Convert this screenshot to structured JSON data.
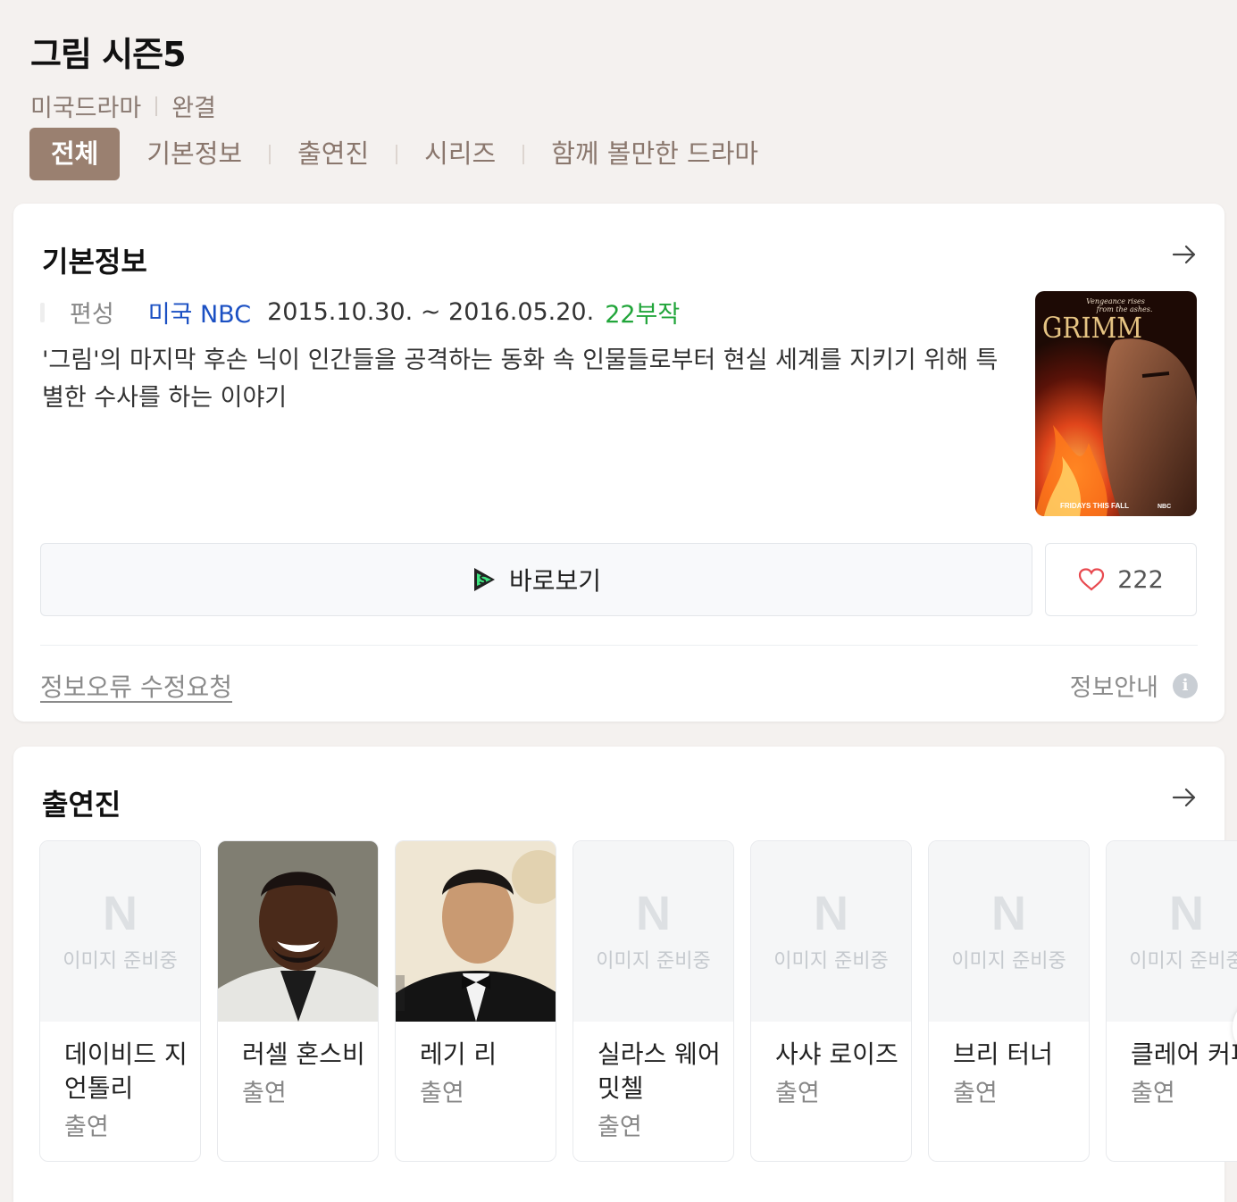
{
  "header": {
    "title": "그림 시즌5",
    "genre": "미국드라마",
    "status": "완결"
  },
  "tabs": [
    {
      "label": "전체",
      "active": true
    },
    {
      "label": "기본정보"
    },
    {
      "label": "출연진"
    },
    {
      "label": "시리즈"
    },
    {
      "label": "함께 볼만한 드라마"
    }
  ],
  "info": {
    "heading": "기본정보",
    "meta_label": "편성",
    "network": "미국 NBC",
    "dates": "2015.10.30. ~ 2016.05.20.",
    "episodes": "22부작",
    "description": "'그림'의 마지막 후손 닉이 인간들을 공격하는 동화 속 인물들로부터 현실 세계를 지키기 위해 특별한 수사를 하는 이야기",
    "poster": {
      "tagline_1": "Vengeance rises",
      "tagline_2": "from the ashes.",
      "logo": "GRIMM",
      "footer": "FRIDAYS THIS FALL",
      "footer_net": "NBC"
    },
    "watch_label": "바로보기",
    "like_count": "222",
    "edit_request": "정보오류 수정요청",
    "info_guide": "정보안내",
    "info_icon": "i"
  },
  "cast": {
    "heading": "출연진",
    "placeholder_logo": "N",
    "placeholder_text": "이미지 준비중",
    "members": [
      {
        "name": "데이비드 지언톨리",
        "role": "출연",
        "has_photo": false
      },
      {
        "name": "러셀 혼스비",
        "role": "출연",
        "has_photo": true
      },
      {
        "name": "레기 리",
        "role": "출연",
        "has_photo": true
      },
      {
        "name": "실라스 웨어 밋첼",
        "role": "출연",
        "has_photo": false
      },
      {
        "name": "사샤 로이즈",
        "role": "출연",
        "has_photo": false
      },
      {
        "name": "브리 터너",
        "role": "출연",
        "has_photo": false
      },
      {
        "name": "클레어 커피",
        "role": "출연",
        "has_photo": false
      }
    ]
  },
  "colors": {
    "background": "#f4f1ef",
    "active_tab": "#9a8070",
    "network_link": "#1b50c3",
    "episodes": "#21a53a",
    "heart": "#e8494f"
  }
}
